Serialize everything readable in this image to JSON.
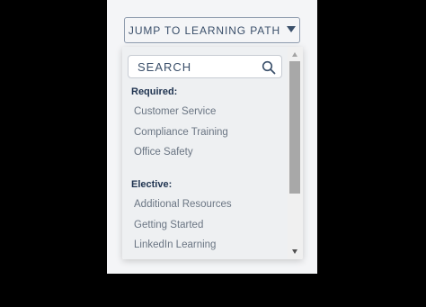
{
  "header": {
    "jump_button_label": "JUMP TO LEARNING PATH",
    "caret_icon": "caret-down-icon"
  },
  "search": {
    "placeholder": "SEARCH",
    "value": "",
    "icon": "search-icon"
  },
  "groups": {
    "required": {
      "label": "Required:",
      "items": [
        "Customer Service",
        "Compliance Training",
        "Office Safety"
      ]
    },
    "elective": {
      "label": "Elective:",
      "items": [
        "Additional Resources",
        "Getting Started",
        "LinkedIn Learning"
      ]
    }
  },
  "colors": {
    "accent": "#3a4f6a",
    "group_label": "#1f3350",
    "item_text": "#6a7583"
  }
}
